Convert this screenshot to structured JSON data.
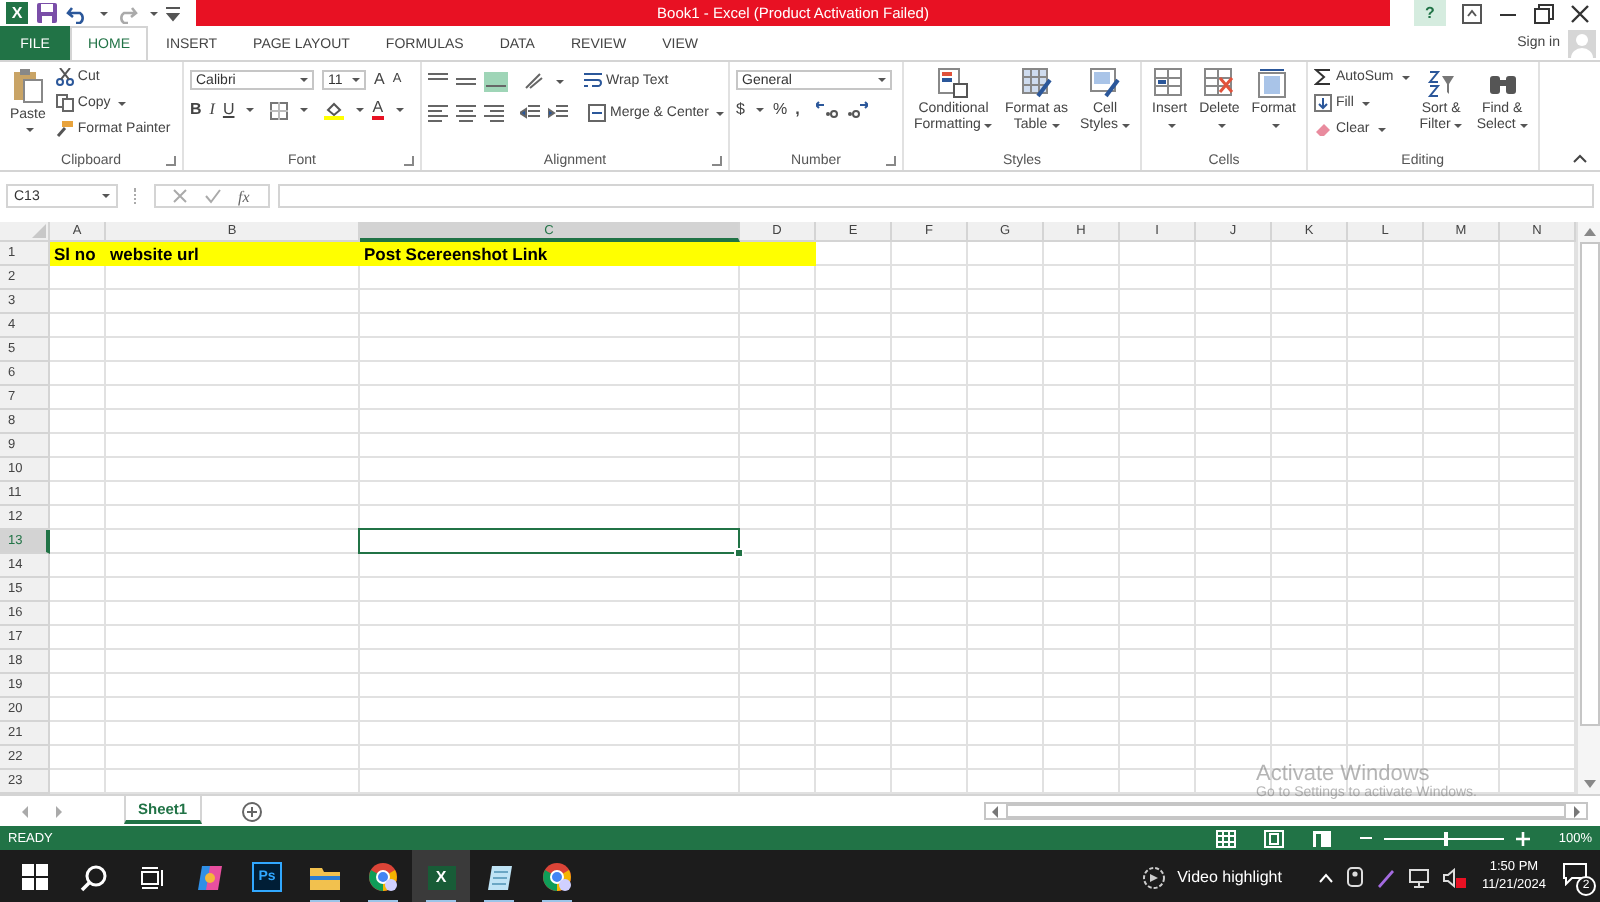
{
  "window": {
    "app_glyph": "X",
    "title": "Book1 -  Excel (Product Activation Failed)",
    "help": "?"
  },
  "ribbon_tabs": [
    {
      "label": "FILE",
      "kind": "file",
      "selected": false
    },
    {
      "label": "HOME",
      "kind": "tab",
      "selected": true
    },
    {
      "label": "INSERT",
      "kind": "tab",
      "selected": false
    },
    {
      "label": "PAGE LAYOUT",
      "kind": "tab",
      "selected": false
    },
    {
      "label": "FORMULAS",
      "kind": "tab",
      "selected": false
    },
    {
      "label": "DATA",
      "kind": "tab",
      "selected": false
    },
    {
      "label": "REVIEW",
      "kind": "tab",
      "selected": false
    },
    {
      "label": "VIEW",
      "kind": "tab",
      "selected": false
    }
  ],
  "sign_in": "Sign in",
  "clipboard": {
    "label": "Clipboard",
    "paste": "Paste",
    "cut": "Cut",
    "copy": "Copy",
    "format_painter": "Format Painter"
  },
  "font": {
    "label": "Font",
    "name": "Calibri",
    "size": "11",
    "grow": "A",
    "shrink": "A",
    "bold": "B",
    "italic": "I",
    "underline": "U",
    "font_color": "A"
  },
  "alignment": {
    "label": "Alignment",
    "wrap": "Wrap Text",
    "merge": "Merge & Center"
  },
  "number": {
    "label": "Number",
    "format": "General",
    "currency": "$",
    "percent": "%",
    "comma": ","
  },
  "styles": {
    "label": "Styles",
    "buttons": [
      {
        "lines": [
          "Conditional",
          "Formatting"
        ],
        "kind": "conditional"
      },
      {
        "lines": [
          "Format as",
          "Table"
        ],
        "kind": "table"
      },
      {
        "lines": [
          "Cell",
          "Styles"
        ],
        "kind": "cell"
      }
    ]
  },
  "cells": {
    "label": "Cells",
    "buttons": [
      {
        "label": "Insert",
        "kind": "insert"
      },
      {
        "label": "Delete",
        "kind": "delete"
      },
      {
        "label": "Format",
        "kind": "format"
      }
    ]
  },
  "editing": {
    "label": "Editing",
    "autosum": "AutoSum",
    "fill": "Fill",
    "clear": "Clear",
    "sort": [
      "Sort &",
      "Filter"
    ],
    "find": [
      "Find &",
      "Select"
    ]
  },
  "formula_bar": {
    "name_box": "C13",
    "fx": "fx"
  },
  "sheet": {
    "columns": [
      {
        "label": "A",
        "selected": false
      },
      {
        "label": "B",
        "selected": false
      },
      {
        "label": "C",
        "selected": true
      },
      {
        "label": "D",
        "selected": false
      },
      {
        "label": "E",
        "selected": false
      },
      {
        "label": "F",
        "selected": false
      },
      {
        "label": "G",
        "selected": false
      },
      {
        "label": "H",
        "selected": false
      },
      {
        "label": "I",
        "selected": false
      },
      {
        "label": "J",
        "selected": false
      },
      {
        "label": "K",
        "selected": false
      },
      {
        "label": "L",
        "selected": false
      },
      {
        "label": "M",
        "selected": false
      },
      {
        "label": "N",
        "selected": false
      }
    ],
    "rows": [
      {
        "label": "1",
        "selected": false,
        "highlighted": true,
        "cells": [
          "Sl no",
          "website url",
          "Post Scereenshot Link"
        ]
      },
      {
        "label": "2",
        "selected": false,
        "highlighted": false
      },
      {
        "label": "3",
        "selected": false,
        "highlighted": false
      },
      {
        "label": "4",
        "selected": false,
        "highlighted": false
      },
      {
        "label": "5",
        "selected": false,
        "highlighted": false
      },
      {
        "label": "6",
        "selected": false,
        "highlighted": false
      },
      {
        "label": "7",
        "selected": false,
        "highlighted": false
      },
      {
        "label": "8",
        "selected": false,
        "highlighted": false
      },
      {
        "label": "9",
        "selected": false,
        "highlighted": false
      },
      {
        "label": "10",
        "selected": false,
        "highlighted": false
      },
      {
        "label": "11",
        "selected": false,
        "highlighted": false
      },
      {
        "label": "12",
        "selected": false,
        "highlighted": false
      },
      {
        "label": "13",
        "selected": true,
        "highlighted": false
      },
      {
        "label": "14",
        "selected": false,
        "highlighted": false
      },
      {
        "label": "15",
        "selected": false,
        "highlighted": false
      },
      {
        "label": "16",
        "selected": false,
        "highlighted": false
      },
      {
        "label": "17",
        "selected": false,
        "highlighted": false
      },
      {
        "label": "18",
        "selected": false,
        "highlighted": false
      },
      {
        "label": "19",
        "selected": false,
        "highlighted": false
      },
      {
        "label": "20",
        "selected": false,
        "highlighted": false
      },
      {
        "label": "21",
        "selected": false,
        "highlighted": false
      },
      {
        "label": "22",
        "selected": false,
        "highlighted": false
      },
      {
        "label": "23",
        "selected": false,
        "highlighted": false
      }
    ]
  },
  "sheet_tabs": [
    {
      "label": "Sheet1",
      "selected": true
    }
  ],
  "status_bar": {
    "text": "READY",
    "zoom_slider": {
      "level": 0.5
    },
    "zoom": "100%"
  },
  "watermark": {
    "title": "Activate Windows",
    "subtitle": "Go to Settings to activate Windows."
  },
  "taskbar": {
    "apps": [
      {
        "kind": "windows",
        "selected": false,
        "running": false
      },
      {
        "kind": "search",
        "selected": false,
        "running": false
      },
      {
        "kind": "taskview",
        "selected": false,
        "running": false
      },
      {
        "kind": "copilot",
        "selected": false,
        "running": false
      },
      {
        "kind": "photoshop",
        "glyph": "Ps",
        "selected": false,
        "running": false
      },
      {
        "kind": "folder",
        "selected": false,
        "running": true
      },
      {
        "kind": "chrome",
        "selected": false,
        "running": true
      },
      {
        "kind": "excel",
        "glyph": "X",
        "selected": true,
        "running": true
      },
      {
        "kind": "notes",
        "selected": false,
        "running": true
      },
      {
        "kind": "chrome",
        "selected": false,
        "running": true
      }
    ],
    "widget": "Video highlight",
    "time": "1:50 PM",
    "date": "11/21/2024",
    "notifications": "2"
  }
}
